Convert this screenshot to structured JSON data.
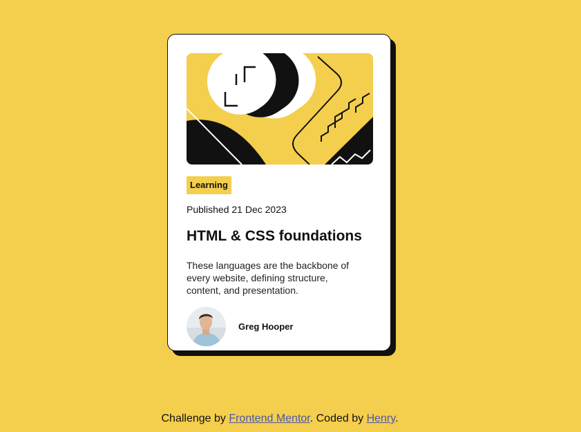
{
  "card": {
    "tag": "Learning",
    "published": "Published 21 Dec 2023",
    "title": "HTML & CSS foundations",
    "description": "These languages are the backbone of every website, defining structure, content, and presentation.",
    "author": "Greg Hooper"
  },
  "footer": {
    "prefix": "Challenge by ",
    "challenge_link": "Frontend Mentor",
    "middle": ". Coded by ",
    "author_link": "Henry",
    "suffix": "."
  },
  "colors": {
    "background": "#F4CE4D",
    "card": "#FFFFFF",
    "ink": "#111111",
    "link": "#4A56A8"
  },
  "icons": {
    "hero_illustration": "abstract-illustration",
    "avatar": "author-avatar"
  }
}
